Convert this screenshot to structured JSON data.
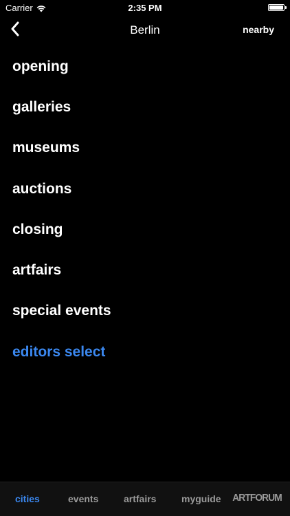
{
  "status_bar": {
    "carrier": "Carrier",
    "time": "2:35 PM",
    "battery_level": 1.0,
    "wifi_icon": "wifi-icon"
  },
  "nav": {
    "back_icon": "chevron-left-icon",
    "title": "Berlin",
    "right_button": "nearby"
  },
  "menu": {
    "items": [
      {
        "label": "opening"
      },
      {
        "label": "galleries"
      },
      {
        "label": "museums"
      },
      {
        "label": "auctions"
      },
      {
        "label": "closing"
      },
      {
        "label": "artfairs"
      },
      {
        "label": "special events"
      },
      {
        "label": "editors select"
      }
    ],
    "highlighted_index": 7
  },
  "tab_bar": {
    "tabs": [
      {
        "label": "cities"
      },
      {
        "label": "events"
      },
      {
        "label": "artfairs"
      },
      {
        "label": "myguide"
      }
    ],
    "active_index": 0,
    "logo": "ARTFORUM"
  },
  "colors": {
    "background": "#000000",
    "accent": "#3b88f0",
    "inactive_tab": "#9a9a9a",
    "tab_bar_bg": "#111111"
  }
}
